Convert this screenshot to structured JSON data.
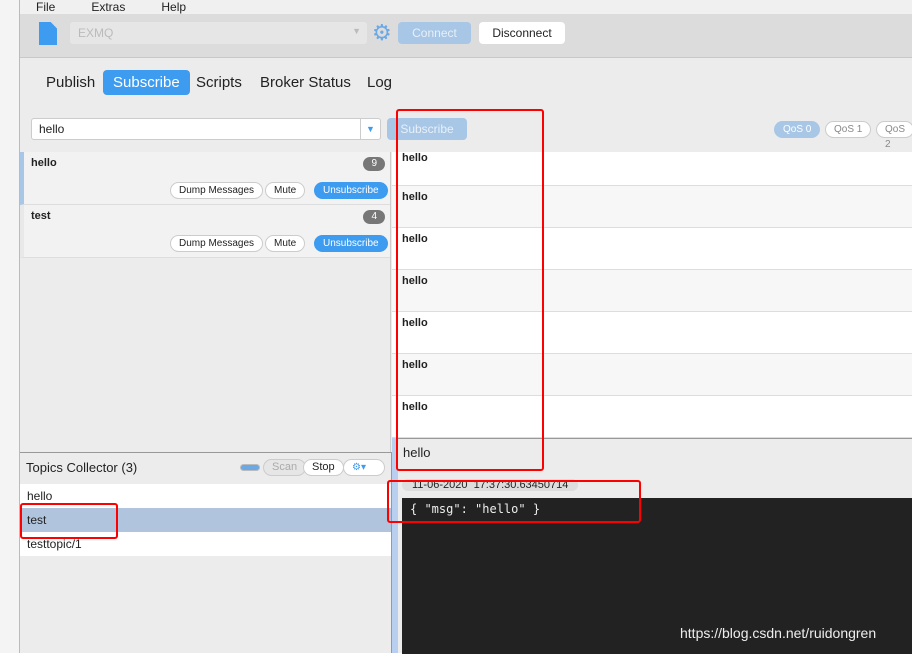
{
  "menu": [
    "File",
    "Extras",
    "Help"
  ],
  "toolbar": {
    "connection": "EXMQ",
    "connect": "Connect",
    "disconnect": "Disconnect"
  },
  "tabs": [
    "Publish",
    "Subscribe",
    "Scripts",
    "Broker Status",
    "Log"
  ],
  "subscribe": {
    "topic_value": "hello",
    "button": "Subscribe",
    "qos": [
      "QoS 0",
      "QoS 1",
      "QoS 2"
    ]
  },
  "subscriptions": [
    {
      "topic": "hello",
      "count": "9",
      "dump": "Dump Messages",
      "mute": "Mute",
      "unsubscribe": "Unsubscribe"
    },
    {
      "topic": "test",
      "count": "4",
      "dump": "Dump Messages",
      "mute": "Mute",
      "unsubscribe": "Unsubscribe"
    }
  ],
  "messages": [
    "hello",
    "hello",
    "hello",
    "hello",
    "hello",
    "hello",
    "hello"
  ],
  "detail": {
    "topic": "hello",
    "timestamp": "11-06-2020  17:37:30.63450714",
    "payload": "{ \"msg\": \"hello\" }"
  },
  "collector": {
    "title": "Topics Collector (3)",
    "scan": "Scan",
    "stop": "Stop",
    "topics": [
      "hello",
      "test",
      "testtopic/1"
    ]
  },
  "watermark": "https://blog.csdn.net/ruidongren",
  "colors": {
    "accent": "#3d9bf0",
    "annotation": "#ff0000",
    "selected": "#b0c4de"
  }
}
